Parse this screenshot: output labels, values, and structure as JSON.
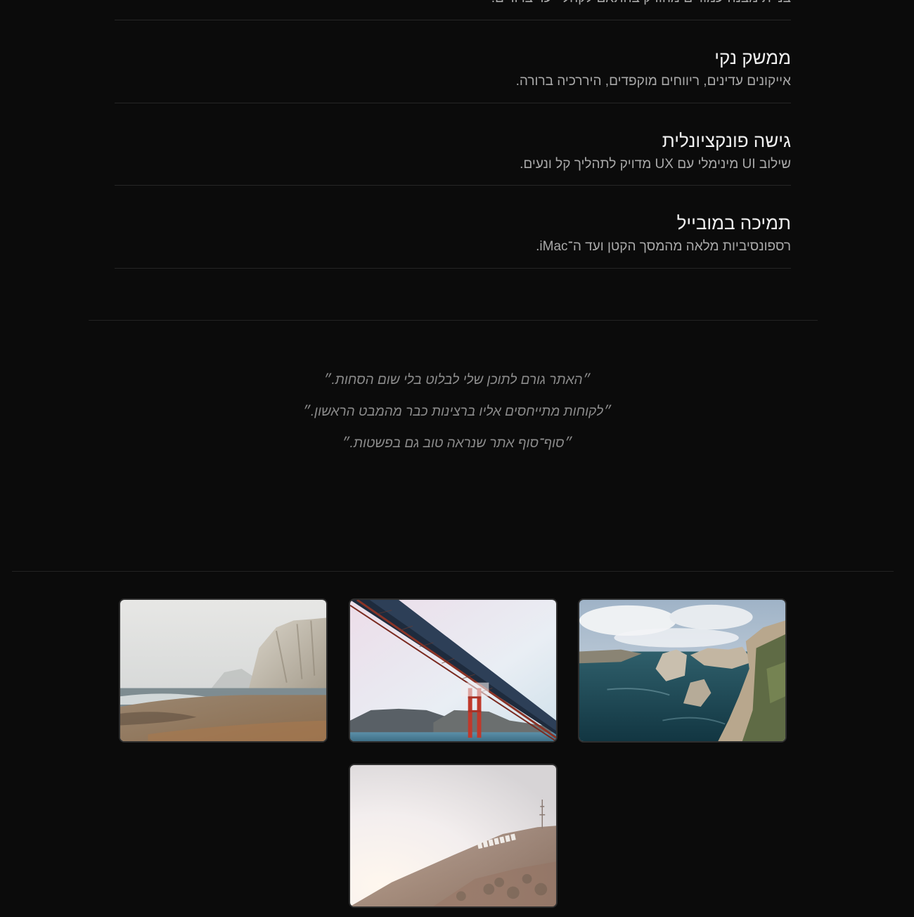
{
  "features": {
    "cut_desc": "בניית מבנה עמודים מהודק בהתאם לקהלי יעד ברורים.",
    "items": [
      {
        "title": "ממשק נקי",
        "desc": "אייקונים עדינים, ריווחים מוקפדים, היררכיה ברורה."
      },
      {
        "title": "גישה פונקציונלית",
        "desc": "שילוב UI מינימלי עם UX מדויק לתהליך קל ונעים."
      },
      {
        "title": "תמיכה במובייל",
        "desc": "רספונסיביות מלאה מהמסך הקטן ועד ה־iMac."
      }
    ]
  },
  "testimonials": [
    "״האתר גורם לתוכן שלי לבלוט בלי שום הסחות.״",
    "״לקוחות מתייחסים אליו ברצינות כבר מהמבט הראשון.״",
    "״סוף־סוף אתר שנראה טוב גם בפשטות.״"
  ],
  "gallery": {
    "photos": [
      "coastal-cliff-beach-photo",
      "golden-gate-bridge-photo",
      "rocky-sea-coast-photo",
      "hollywood-sign-hill-photo"
    ]
  }
}
